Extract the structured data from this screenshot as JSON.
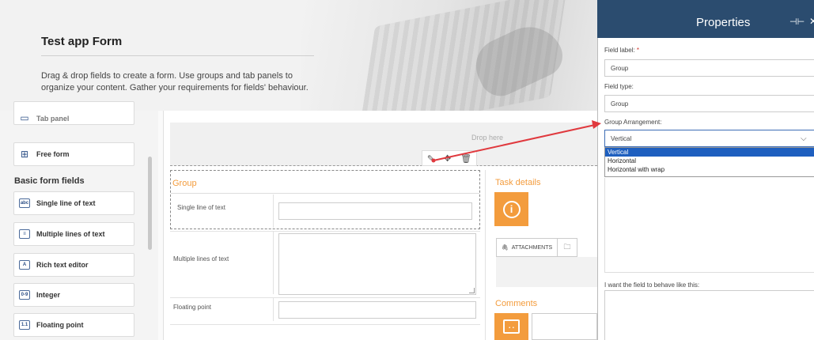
{
  "header": {
    "title": "Test app Form",
    "description_line1": "Drag & drop fields to create a form. Use groups and tab panels to",
    "description_line2": "organize your content. Gather your requirements for fields' behaviour."
  },
  "palette": {
    "partial_item": "Tab panel",
    "free_form": "Free form",
    "basic_heading": "Basic form fields",
    "items": [
      {
        "label": "Single line of text",
        "icon": "abc"
      },
      {
        "label": "Multiple lines of text",
        "icon": "≡"
      },
      {
        "label": "Rich text editor",
        "icon": "A"
      },
      {
        "label": "Integer",
        "icon": "0-9"
      },
      {
        "label": "Floating point",
        "icon": "1.1"
      }
    ]
  },
  "canvas": {
    "drop_here": "Drop here",
    "group_title": "Group",
    "fields": {
      "single_line": "Single line of text",
      "multi_line": "Multiple lines of text",
      "floating_point": "Floating point"
    },
    "task_details": "Task details",
    "attachments_tab": "ATTACHMENTS",
    "comments": "Comments"
  },
  "properties": {
    "title": "Properties",
    "field_label_label": "Field label:",
    "required_mark": "*",
    "field_label_value": "Group",
    "field_type_label": "Field type:",
    "field_type_value": "Group",
    "arrangement_label": "Group Arrangement:",
    "arrangement_value": "Vertical",
    "arrangement_options": [
      "Vertical",
      "Horizontal",
      "Horizontal with wrap"
    ],
    "behave_label": "I want the field to behave like this:"
  },
  "colors": {
    "panel_header": "#2b4c6f",
    "accent_orange": "#f39c3d",
    "selection_blue": "#1e5fbf",
    "annotation_arrow": "#e0393e"
  }
}
